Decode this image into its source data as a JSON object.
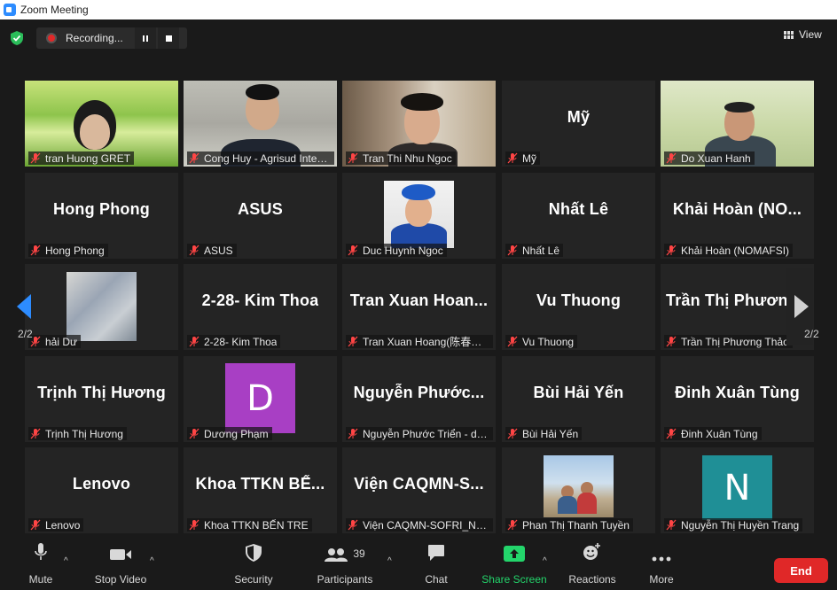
{
  "window": {
    "title": "Zoom Meeting"
  },
  "recording": {
    "label": "Recording..."
  },
  "view_button": {
    "label": "View"
  },
  "pagination": {
    "left": "2/2",
    "right": "2/2"
  },
  "participants": [
    {
      "display": "",
      "label": "tran Huong GRET"
    },
    {
      "display": "",
      "label": "Cong Huy - Agrisud Internati..."
    },
    {
      "display": "",
      "label": "Tran Thi Nhu Ngoc"
    },
    {
      "display": "Mỹ",
      "label": "Mỹ"
    },
    {
      "display": "",
      "label": "Do Xuan Hanh"
    },
    {
      "display": "Hong Phong",
      "label": "Hong Phong"
    },
    {
      "display": "ASUS",
      "label": "ASUS"
    },
    {
      "display": "",
      "label": "Duc Huynh Ngoc"
    },
    {
      "display": "Nhất Lê",
      "label": "Nhất Lê"
    },
    {
      "display": "Khải Hoàn (NO...",
      "label": "Khải Hoàn (NOMAFSI)"
    },
    {
      "display": "",
      "label": "hải Dư"
    },
    {
      "display": "2-28- Kim Thoa",
      "label": "2-28- Kim Thoa"
    },
    {
      "display": "Tran Xuan Hoan...",
      "label": "Tran Xuan Hoang(陈春黄..."
    },
    {
      "display": "Vu Thuong",
      "label": "Vu Thuong"
    },
    {
      "display": "Trần Thị Phươn",
      "label": "Trần Thị Phương Thảo"
    },
    {
      "display": "Trịnh Thị Hương",
      "label": "Trịnh Thị Hương"
    },
    {
      "display": "",
      "label": "Dương Phạm",
      "avatar_letter": "D",
      "avatar_color": "#a83fc4"
    },
    {
      "display": "Nguyễn Phước...",
      "label": "Nguyễn Phước Triển - dtcc"
    },
    {
      "display": "Bùi Hải Yến",
      "label": "Bùi Hải Yến"
    },
    {
      "display": "Đinh Xuân Tùng",
      "label": "Đinh Xuân Tùng"
    },
    {
      "display": "Lenovo",
      "label": "Lenovo"
    },
    {
      "display": "Khoa TTKN BẾ...",
      "label": "Khoa TTKN BẾN TRE"
    },
    {
      "display": "Viện CAQMN-S...",
      "label": "Viện CAQMN-SOFRI_Ng ..."
    },
    {
      "display": "",
      "label": "Phan Thị Thanh Tuyền"
    },
    {
      "display": "",
      "label": "Nguyễn Thị Huyền Trang",
      "avatar_letter": "N",
      "avatar_color": "#1f8f96"
    }
  ],
  "toolbar": {
    "mute": "Mute",
    "stop_video": "Stop Video",
    "security": "Security",
    "participants": "Participants",
    "participants_count": "39",
    "chat": "Chat",
    "share_screen": "Share Screen",
    "reactions": "Reactions",
    "more": "More",
    "end": "End"
  },
  "colors": {
    "accent_green": "#23d56b",
    "end_red": "#e02828",
    "shield_green": "#2bbd5a"
  }
}
